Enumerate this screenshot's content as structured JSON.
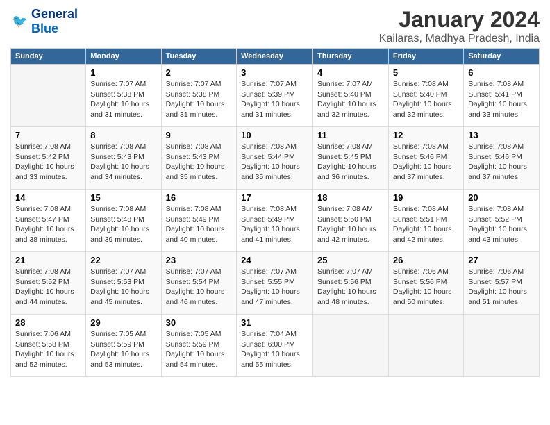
{
  "logo": {
    "general": "General",
    "blue": "Blue"
  },
  "title": "January 2024",
  "subtitle": "Kailaras, Madhya Pradesh, India",
  "days_header": [
    "Sunday",
    "Monday",
    "Tuesday",
    "Wednesday",
    "Thursday",
    "Friday",
    "Saturday"
  ],
  "weeks": [
    [
      {
        "num": "",
        "sunrise": "",
        "sunset": "",
        "daylight": ""
      },
      {
        "num": "1",
        "sunrise": "Sunrise: 7:07 AM",
        "sunset": "Sunset: 5:38 PM",
        "daylight": "Daylight: 10 hours and 31 minutes."
      },
      {
        "num": "2",
        "sunrise": "Sunrise: 7:07 AM",
        "sunset": "Sunset: 5:38 PM",
        "daylight": "Daylight: 10 hours and 31 minutes."
      },
      {
        "num": "3",
        "sunrise": "Sunrise: 7:07 AM",
        "sunset": "Sunset: 5:39 PM",
        "daylight": "Daylight: 10 hours and 31 minutes."
      },
      {
        "num": "4",
        "sunrise": "Sunrise: 7:07 AM",
        "sunset": "Sunset: 5:40 PM",
        "daylight": "Daylight: 10 hours and 32 minutes."
      },
      {
        "num": "5",
        "sunrise": "Sunrise: 7:08 AM",
        "sunset": "Sunset: 5:40 PM",
        "daylight": "Daylight: 10 hours and 32 minutes."
      },
      {
        "num": "6",
        "sunrise": "Sunrise: 7:08 AM",
        "sunset": "Sunset: 5:41 PM",
        "daylight": "Daylight: 10 hours and 33 minutes."
      }
    ],
    [
      {
        "num": "7",
        "sunrise": "Sunrise: 7:08 AM",
        "sunset": "Sunset: 5:42 PM",
        "daylight": "Daylight: 10 hours and 33 minutes."
      },
      {
        "num": "8",
        "sunrise": "Sunrise: 7:08 AM",
        "sunset": "Sunset: 5:43 PM",
        "daylight": "Daylight: 10 hours and 34 minutes."
      },
      {
        "num": "9",
        "sunrise": "Sunrise: 7:08 AM",
        "sunset": "Sunset: 5:43 PM",
        "daylight": "Daylight: 10 hours and 35 minutes."
      },
      {
        "num": "10",
        "sunrise": "Sunrise: 7:08 AM",
        "sunset": "Sunset: 5:44 PM",
        "daylight": "Daylight: 10 hours and 35 minutes."
      },
      {
        "num": "11",
        "sunrise": "Sunrise: 7:08 AM",
        "sunset": "Sunset: 5:45 PM",
        "daylight": "Daylight: 10 hours and 36 minutes."
      },
      {
        "num": "12",
        "sunrise": "Sunrise: 7:08 AM",
        "sunset": "Sunset: 5:46 PM",
        "daylight": "Daylight: 10 hours and 37 minutes."
      },
      {
        "num": "13",
        "sunrise": "Sunrise: 7:08 AM",
        "sunset": "Sunset: 5:46 PM",
        "daylight": "Daylight: 10 hours and 37 minutes."
      }
    ],
    [
      {
        "num": "14",
        "sunrise": "Sunrise: 7:08 AM",
        "sunset": "Sunset: 5:47 PM",
        "daylight": "Daylight: 10 hours and 38 minutes."
      },
      {
        "num": "15",
        "sunrise": "Sunrise: 7:08 AM",
        "sunset": "Sunset: 5:48 PM",
        "daylight": "Daylight: 10 hours and 39 minutes."
      },
      {
        "num": "16",
        "sunrise": "Sunrise: 7:08 AM",
        "sunset": "Sunset: 5:49 PM",
        "daylight": "Daylight: 10 hours and 40 minutes."
      },
      {
        "num": "17",
        "sunrise": "Sunrise: 7:08 AM",
        "sunset": "Sunset: 5:49 PM",
        "daylight": "Daylight: 10 hours and 41 minutes."
      },
      {
        "num": "18",
        "sunrise": "Sunrise: 7:08 AM",
        "sunset": "Sunset: 5:50 PM",
        "daylight": "Daylight: 10 hours and 42 minutes."
      },
      {
        "num": "19",
        "sunrise": "Sunrise: 7:08 AM",
        "sunset": "Sunset: 5:51 PM",
        "daylight": "Daylight: 10 hours and 42 minutes."
      },
      {
        "num": "20",
        "sunrise": "Sunrise: 7:08 AM",
        "sunset": "Sunset: 5:52 PM",
        "daylight": "Daylight: 10 hours and 43 minutes."
      }
    ],
    [
      {
        "num": "21",
        "sunrise": "Sunrise: 7:08 AM",
        "sunset": "Sunset: 5:52 PM",
        "daylight": "Daylight: 10 hours and 44 minutes."
      },
      {
        "num": "22",
        "sunrise": "Sunrise: 7:07 AM",
        "sunset": "Sunset: 5:53 PM",
        "daylight": "Daylight: 10 hours and 45 minutes."
      },
      {
        "num": "23",
        "sunrise": "Sunrise: 7:07 AM",
        "sunset": "Sunset: 5:54 PM",
        "daylight": "Daylight: 10 hours and 46 minutes."
      },
      {
        "num": "24",
        "sunrise": "Sunrise: 7:07 AM",
        "sunset": "Sunset: 5:55 PM",
        "daylight": "Daylight: 10 hours and 47 minutes."
      },
      {
        "num": "25",
        "sunrise": "Sunrise: 7:07 AM",
        "sunset": "Sunset: 5:56 PM",
        "daylight": "Daylight: 10 hours and 48 minutes."
      },
      {
        "num": "26",
        "sunrise": "Sunrise: 7:06 AM",
        "sunset": "Sunset: 5:56 PM",
        "daylight": "Daylight: 10 hours and 50 minutes."
      },
      {
        "num": "27",
        "sunrise": "Sunrise: 7:06 AM",
        "sunset": "Sunset: 5:57 PM",
        "daylight": "Daylight: 10 hours and 51 minutes."
      }
    ],
    [
      {
        "num": "28",
        "sunrise": "Sunrise: 7:06 AM",
        "sunset": "Sunset: 5:58 PM",
        "daylight": "Daylight: 10 hours and 52 minutes."
      },
      {
        "num": "29",
        "sunrise": "Sunrise: 7:05 AM",
        "sunset": "Sunset: 5:59 PM",
        "daylight": "Daylight: 10 hours and 53 minutes."
      },
      {
        "num": "30",
        "sunrise": "Sunrise: 7:05 AM",
        "sunset": "Sunset: 5:59 PM",
        "daylight": "Daylight: 10 hours and 54 minutes."
      },
      {
        "num": "31",
        "sunrise": "Sunrise: 7:04 AM",
        "sunset": "Sunset: 6:00 PM",
        "daylight": "Daylight: 10 hours and 55 minutes."
      },
      {
        "num": "",
        "sunrise": "",
        "sunset": "",
        "daylight": ""
      },
      {
        "num": "",
        "sunrise": "",
        "sunset": "",
        "daylight": ""
      },
      {
        "num": "",
        "sunrise": "",
        "sunset": "",
        "daylight": ""
      }
    ]
  ]
}
